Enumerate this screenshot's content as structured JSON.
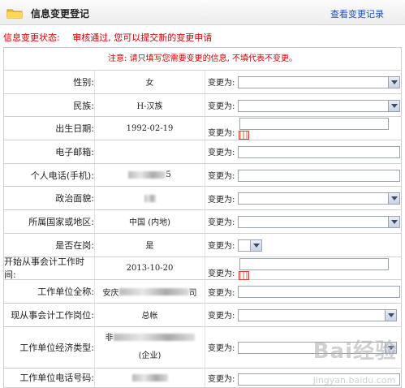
{
  "header": {
    "title": "信息变更登记",
    "link": "查看变更记录"
  },
  "status": {
    "label": "信息变更状态:",
    "value": "审核通过, 您可以提交新的变更申请"
  },
  "notice": "注意: 请只填写您需要变更的信息, 不填代表不变更。",
  "change_label": "变更为:",
  "fields": [
    {
      "label": "性别:",
      "value": "女",
      "control": "select"
    },
    {
      "label": "民族:",
      "value": "H-汉族",
      "control": "select"
    },
    {
      "label": "出生日期:",
      "value": "1992-02-19",
      "control": "date"
    },
    {
      "label": "电子邮箱:",
      "value": "",
      "control": "input"
    },
    {
      "label": "个人电话(手机):",
      "value": "5",
      "control": "input"
    },
    {
      "label": "政治面貌:",
      "value": "",
      "control": "select"
    },
    {
      "label": "所属国家或地区:",
      "value": "中国 (内地)",
      "control": "select"
    },
    {
      "label": "是否在岗:",
      "value": "是",
      "control": "small-select"
    },
    {
      "label": "开始从事会计工作时间:",
      "value": "2013-10-20",
      "control": "date"
    },
    {
      "label": "工作单位全称:",
      "value_prefix": "安庆",
      "value_suffix": "司",
      "control": "input"
    },
    {
      "label": "现从事会计工作岗位:",
      "value": "总帐",
      "control": "select"
    },
    {
      "label": "工作单位经济类型:",
      "value_prefix": "非",
      "value_line2": "(企业)",
      "control": "select"
    },
    {
      "label": "工作单位电话号码:",
      "value": "",
      "control": "input"
    }
  ],
  "watermark": {
    "brand": "Bai",
    "brand2": "经验",
    "small": "jingyan.baidu.com"
  }
}
